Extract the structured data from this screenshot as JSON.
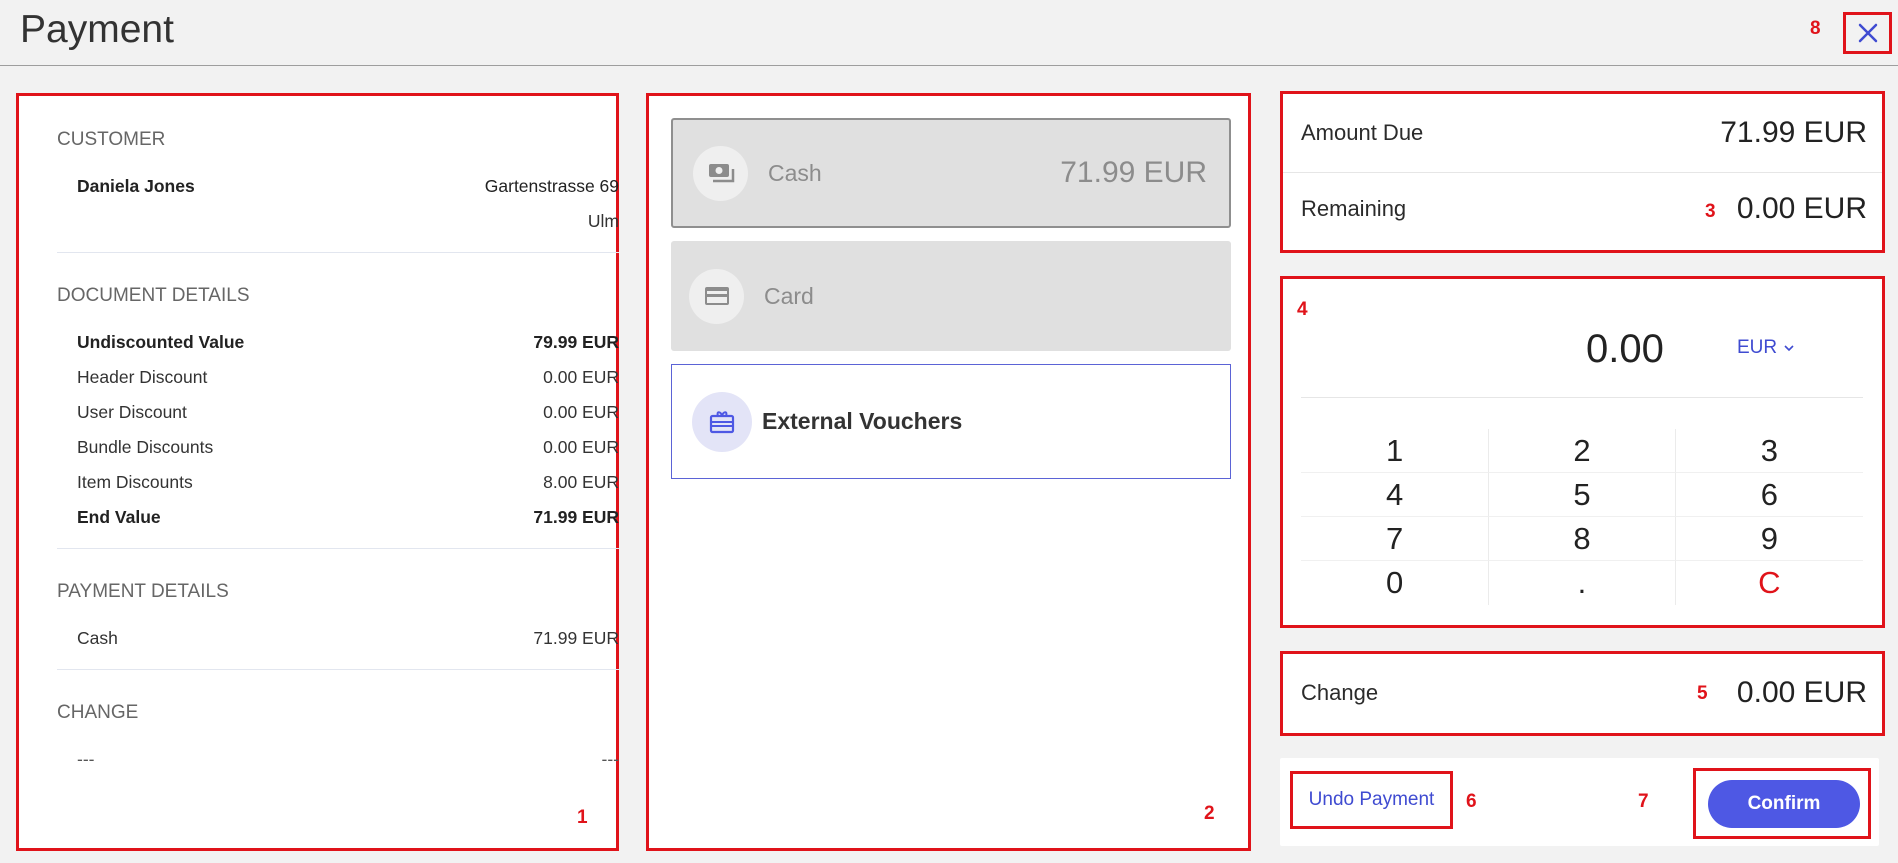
{
  "header": {
    "title": "Payment",
    "close_icon": "close-icon"
  },
  "annotations": [
    "1",
    "2",
    "3",
    "4",
    "5",
    "6",
    "7",
    "8"
  ],
  "summary": {
    "customer_title": "CUSTOMER",
    "customer_name": "Daniela Jones",
    "customer_street": "Gartenstrasse 69",
    "customer_city": "Ulm",
    "document_title": "DOCUMENT DETAILS",
    "document_rows": [
      {
        "label": "Undiscounted Value",
        "value": "79.99 EUR"
      },
      {
        "label": "Header Discount",
        "value": "0.00 EUR"
      },
      {
        "label": "User Discount",
        "value": "0.00 EUR"
      },
      {
        "label": "Bundle Discounts",
        "value": "0.00 EUR"
      },
      {
        "label": "Item Discounts",
        "value": "8.00 EUR"
      },
      {
        "label": "End Value",
        "value": "71.99 EUR"
      }
    ],
    "payment_title": "PAYMENT DETAILS",
    "payment_rows": [
      {
        "label": "Cash",
        "value": "71.99 EUR"
      }
    ],
    "change_title": "CHANGE",
    "change_left": "---",
    "change_right": "---"
  },
  "methods": [
    {
      "label": "Cash",
      "amount": "71.99 EUR",
      "icon": "cash-icon"
    },
    {
      "label": "Card",
      "amount": "",
      "icon": "card-icon"
    },
    {
      "label": "External Vouchers",
      "amount": "",
      "icon": "gift-card-icon"
    }
  ],
  "amounts": {
    "amount_due_label": "Amount Due",
    "amount_due_value": "71.99 EUR",
    "remaining_label": "Remaining",
    "remaining_value": "0.00 EUR"
  },
  "keypad": {
    "display": "0.00",
    "currency": "EUR",
    "keys": [
      "1",
      "2",
      "3",
      "4",
      "5",
      "6",
      "7",
      "8",
      "9",
      "0",
      ".",
      "C"
    ]
  },
  "change": {
    "label": "Change",
    "value": "0.00 EUR"
  },
  "actions": {
    "undo_label": "Undo Payment",
    "confirm_label": "Confirm"
  },
  "colors": {
    "accent": "#4e58e4",
    "annotation": "#e0131a",
    "clear_key": "#e0131a"
  }
}
